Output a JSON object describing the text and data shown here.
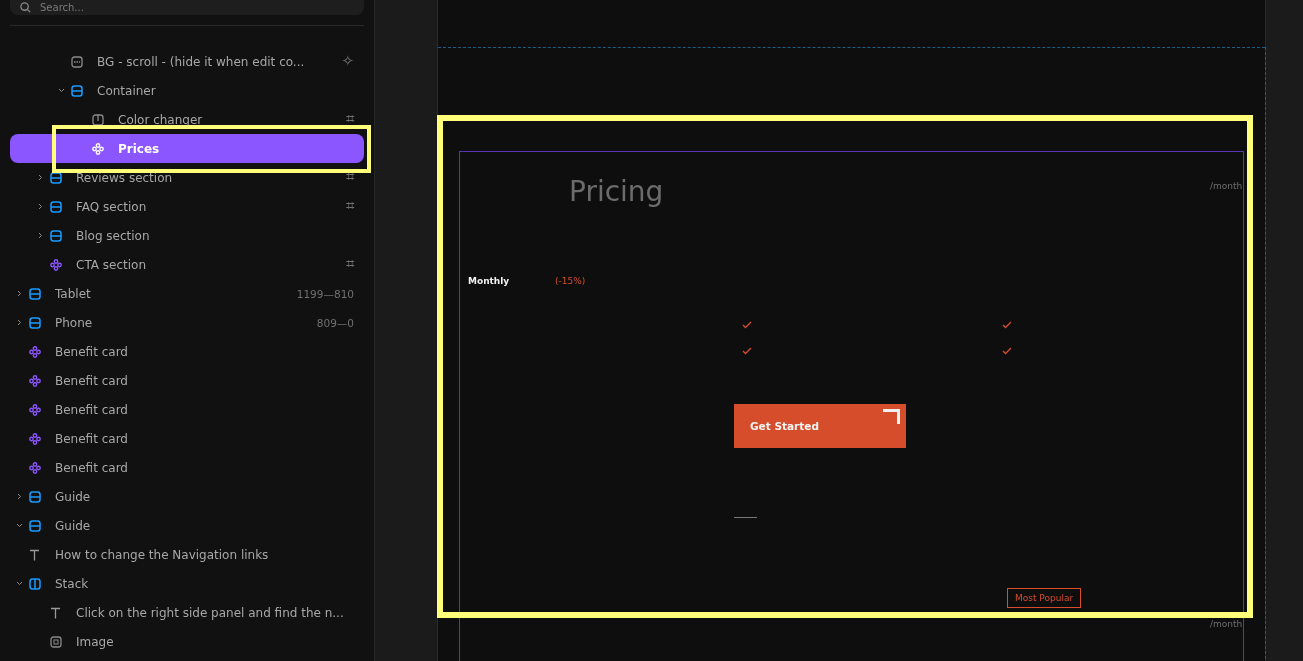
{
  "search": {
    "placeholder": "Search..."
  },
  "layers": [
    {
      "children": [
        {
          "children": [
            {
              "children": [
                {
                  "label": "BG - scroll - (hide it when edit co...",
                  "kind": "background",
                  "meta": "✧",
                  "selected": false
                },
                {
                  "label": "Container",
                  "kind": "frame",
                  "expanded": true,
                  "selected": false,
                  "children": [
                    {
                      "label": "Color changer",
                      "kind": "stack-grey",
                      "meta": "⌗",
                      "selected": false
                    },
                    {
                      "label": "Prices",
                      "kind": "component",
                      "selected": true
                    }
                  ]
                }
              ]
            },
            {
              "label": "Reviews section",
              "kind": "frame",
              "expanded": false,
              "meta": "⌗",
              "selected": false
            },
            {
              "label": "FAQ section",
              "kind": "frame",
              "expanded": false,
              "meta": "⌗",
              "selected": false
            },
            {
              "label": "Blog section",
              "kind": "frame",
              "expanded": false,
              "selected": false
            },
            {
              "label": "CTA section",
              "kind": "component",
              "meta": "⌗",
              "selected": false
            }
          ]
        }
      ]
    },
    {
      "label": "Tablet",
      "kind": "frame",
      "expanded": false,
      "meta": "1199—810",
      "selected": false
    },
    {
      "label": "Phone",
      "kind": "frame",
      "expanded": false,
      "meta": "809—0",
      "selected": false
    },
    {
      "label": "Benefit card",
      "kind": "component",
      "selected": false
    },
    {
      "label": "Benefit card",
      "kind": "component",
      "selected": false
    },
    {
      "label": "Benefit card",
      "kind": "component",
      "selected": false
    },
    {
      "label": "Benefit card",
      "kind": "component",
      "selected": false
    },
    {
      "label": "Benefit card",
      "kind": "component",
      "selected": false
    },
    {
      "label": "Guide",
      "kind": "frame",
      "expanded": false,
      "selected": false
    },
    {
      "label": "Guide",
      "kind": "frame",
      "expanded": true,
      "selected": false,
      "children": [
        {
          "label": "How to change the Navigation links",
          "kind": "text",
          "selected": false
        },
        {
          "label": "Stack",
          "kind": "stack",
          "expanded": true,
          "selected": false,
          "children": [
            {
              "label": "Click on the right side panel and find the n...",
              "kind": "text",
              "selected": false
            },
            {
              "label": "Image",
              "kind": "image",
              "selected": false
            }
          ]
        }
      ]
    }
  ],
  "canvas": {
    "title": "Pricing",
    "price_unit_top": "/month",
    "toggle_label": "Monthly",
    "discount": "(-15%)",
    "cta_button": "Get Started",
    "badge": "Most Popular",
    "price_unit_bottom": "/month"
  }
}
